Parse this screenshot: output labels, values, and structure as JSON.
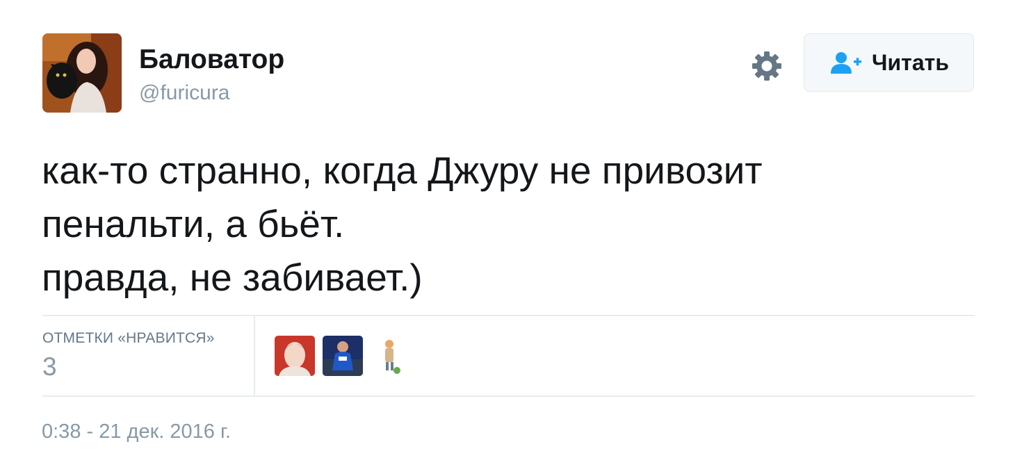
{
  "author": {
    "display_name": "Баловатор",
    "handle": "@furicura",
    "avatar_icon": "profile-photo-woman-with-cat"
  },
  "actions": {
    "settings_icon": "gear-icon",
    "follow_icon": "add-user-icon",
    "follow_label": "Читать",
    "accent_color": "#1da1f2"
  },
  "tweet": {
    "lines": [
      "как-то странно, когда Джуру не привозит",
      "пенальти, а бьёт.",
      "правда, не забивает.)"
    ]
  },
  "likes": {
    "label": "ОТМЕТКИ «НРАВИТСЯ»",
    "count": "3",
    "likers": [
      "liker-avatar-red-portrait",
      "liker-avatar-football-player",
      "liker-avatar-cartoon-figure"
    ]
  },
  "timestamp": "0:38 - 21 дек. 2016 г."
}
